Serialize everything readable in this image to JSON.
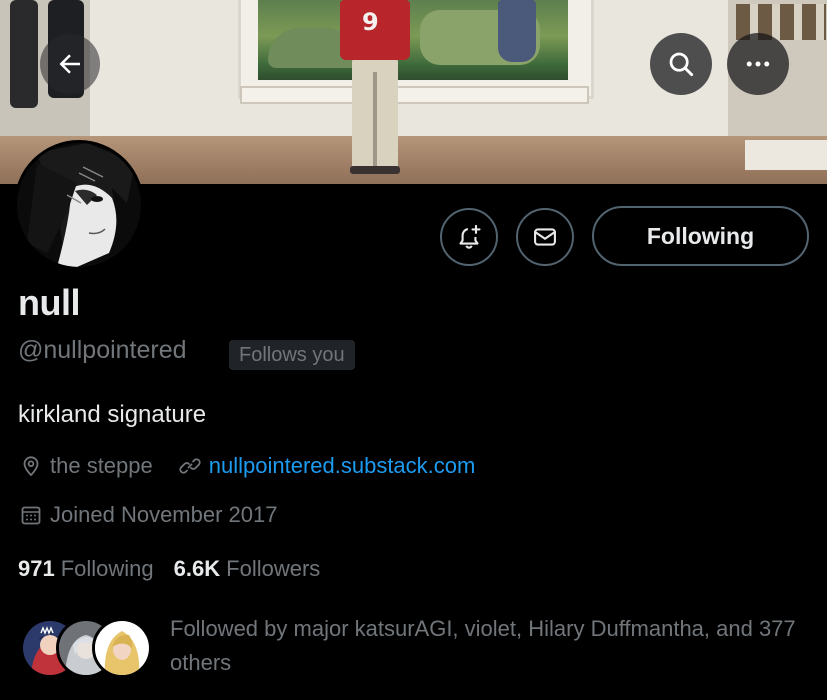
{
  "header": {
    "back_icon": "arrow-left-icon",
    "search_icon": "search-icon",
    "more_icon": "more-horizontal-icon",
    "banner_jersey_number": "9"
  },
  "profile": {
    "display_name": "null",
    "handle": "@nullpointered",
    "follows_you_badge": "Follows you",
    "bio": "kirkland signature",
    "location": "the steppe",
    "website": "nullpointered.substack.com",
    "joined": "Joined November 2017"
  },
  "actions": {
    "notify_icon": "bell-plus-icon",
    "message_icon": "mail-icon",
    "following_label": "Following"
  },
  "stats": {
    "following_count": "971",
    "following_label": "Following",
    "followers_count": "6.6K",
    "followers_label": "Followers"
  },
  "followed_by": {
    "text": "Followed by major katsurAGI, violet, Hilary Duffmantha, and 377 others"
  },
  "colors": {
    "background": "#000000",
    "text_primary": "#e7e9ea",
    "text_secondary": "#71767b",
    "link": "#1d9bf0",
    "border": "#536471"
  }
}
